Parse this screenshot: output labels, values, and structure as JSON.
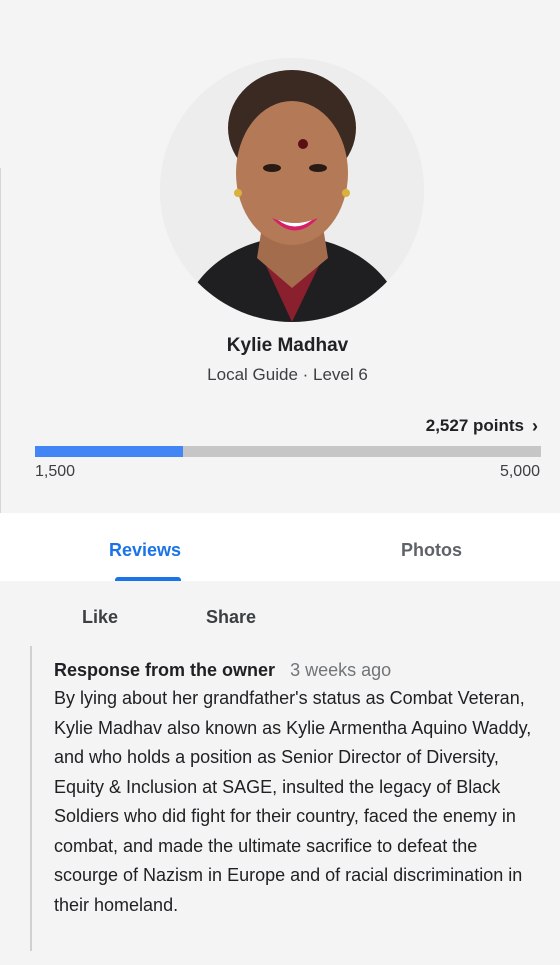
{
  "profile": {
    "name": "Kylie Madhav",
    "level_text": "Local Guide · Level 6",
    "points_label": "2,527 points",
    "progress": {
      "min_label": "1,500",
      "max_label": "5,000",
      "fraction": 0.292
    }
  },
  "tabs": [
    {
      "label": "Reviews",
      "active": true
    },
    {
      "label": "Photos",
      "active": false
    }
  ],
  "actions": {
    "like": "Like",
    "share": "Share"
  },
  "owner_response": {
    "title": "Response from the owner",
    "time": "3 weeks ago",
    "body": "By lying about her grandfather's status as Combat Veteran, Kylie Madhav also known as Kylie Armentha Aquino Waddy, and who holds a position as Senior Director of Diversity, Equity & Inclusion at SAGE, insulted the legacy of Black Soldiers who did fight for their country, faced the enemy in combat, and made the ultimate sacrifice to defeat the scourge of Nazism in Europe and of racial discrimination in their homeland."
  },
  "colors": {
    "accent": "#1a73e8",
    "progress_fill": "#4285f4",
    "progress_track": "#c6c6c6"
  },
  "icons": {
    "points_chevron": "chevron-right-icon"
  }
}
